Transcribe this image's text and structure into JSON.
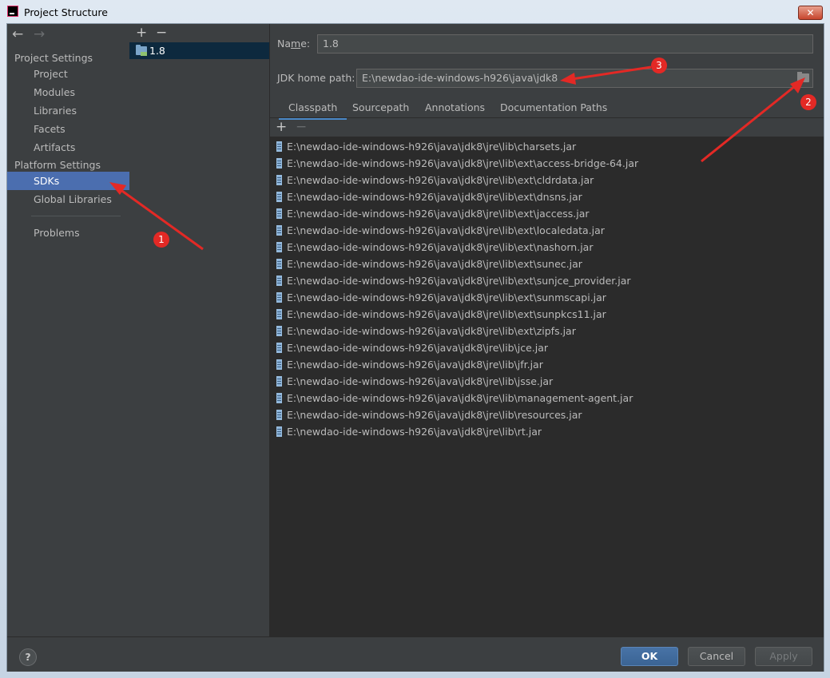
{
  "window": {
    "title": "Project Structure",
    "close_glyph": "✕"
  },
  "nav": {
    "back_glyph": "←",
    "forward_glyph": "→",
    "project_settings_header": "Project Settings",
    "project_items": [
      "Project",
      "Modules",
      "Libraries",
      "Facets",
      "Artifacts"
    ],
    "platform_settings_header": "Platform Settings",
    "platform_items": [
      "SDKs",
      "Global Libraries"
    ],
    "problems": "Problems",
    "selected": "SDKs"
  },
  "sdk_list": {
    "add_glyph": "+",
    "remove_glyph": "−",
    "items": [
      "1.8"
    ]
  },
  "detail": {
    "name_label_prefix": "Na",
    "name_label_mnemonic": "m",
    "name_label_suffix": "e:",
    "name_value": "1.8",
    "jdk_home_label": "JDK home path:",
    "jdk_home_value": "E:\\newdao-ide-windows-h926\\java\\jdk8",
    "tabs": [
      "Classpath",
      "Sourcepath",
      "Annotations",
      "Documentation Paths"
    ],
    "active_tab": "Classpath",
    "classpath_add_glyph": "+",
    "classpath_remove_glyph": "−",
    "classpath": [
      "E:\\newdao-ide-windows-h926\\java\\jdk8\\jre\\lib\\charsets.jar",
      "E:\\newdao-ide-windows-h926\\java\\jdk8\\jre\\lib\\ext\\access-bridge-64.jar",
      "E:\\newdao-ide-windows-h926\\java\\jdk8\\jre\\lib\\ext\\cldrdata.jar",
      "E:\\newdao-ide-windows-h926\\java\\jdk8\\jre\\lib\\ext\\dnsns.jar",
      "E:\\newdao-ide-windows-h926\\java\\jdk8\\jre\\lib\\ext\\jaccess.jar",
      "E:\\newdao-ide-windows-h926\\java\\jdk8\\jre\\lib\\ext\\localedata.jar",
      "E:\\newdao-ide-windows-h926\\java\\jdk8\\jre\\lib\\ext\\nashorn.jar",
      "E:\\newdao-ide-windows-h926\\java\\jdk8\\jre\\lib\\ext\\sunec.jar",
      "E:\\newdao-ide-windows-h926\\java\\jdk8\\jre\\lib\\ext\\sunjce_provider.jar",
      "E:\\newdao-ide-windows-h926\\java\\jdk8\\jre\\lib\\ext\\sunmscapi.jar",
      "E:\\newdao-ide-windows-h926\\java\\jdk8\\jre\\lib\\ext\\sunpkcs11.jar",
      "E:\\newdao-ide-windows-h926\\java\\jdk8\\jre\\lib\\ext\\zipfs.jar",
      "E:\\newdao-ide-windows-h926\\java\\jdk8\\jre\\lib\\jce.jar",
      "E:\\newdao-ide-windows-h926\\java\\jdk8\\jre\\lib\\jfr.jar",
      "E:\\newdao-ide-windows-h926\\java\\jdk8\\jre\\lib\\jsse.jar",
      "E:\\newdao-ide-windows-h926\\java\\jdk8\\jre\\lib\\management-agent.jar",
      "E:\\newdao-ide-windows-h926\\java\\jdk8\\jre\\lib\\resources.jar",
      "E:\\newdao-ide-windows-h926\\java\\jdk8\\jre\\lib\\rt.jar"
    ]
  },
  "buttons": {
    "help": "?",
    "ok": "OK",
    "cancel": "Cancel",
    "apply": "Apply"
  },
  "annotations": {
    "badges": [
      "1",
      "2",
      "3"
    ],
    "color": "#e32925"
  },
  "colors": {
    "accent": "#4b6eaf",
    "primary_button": "#3b6494",
    "panel": "#3c3f41",
    "list_bg": "#2b2b2b"
  }
}
